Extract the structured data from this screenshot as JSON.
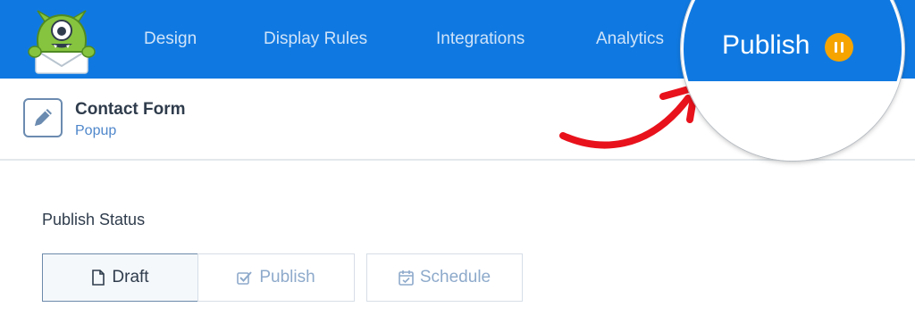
{
  "nav": {
    "items": [
      "Design",
      "Display Rules",
      "Integrations",
      "Analytics"
    ]
  },
  "publish_button": {
    "label": "Publish",
    "status_icon": "pause-icon",
    "status_color": "#f5a400"
  },
  "campaign": {
    "title": "Contact Form",
    "type": "Popup",
    "icon": "pencil-icon"
  },
  "publish_status": {
    "label": "Publish Status",
    "options": [
      {
        "label": "Draft",
        "icon": "file-icon",
        "selected": true
      },
      {
        "label": "Publish",
        "icon": "checkbox-icon",
        "selected": false
      },
      {
        "label": "Schedule",
        "icon": "calendar-icon",
        "selected": false
      }
    ]
  },
  "colors": {
    "brand_blue": "#1079e1",
    "annotation_red": "#e8121c",
    "text_dark": "#2f3c4c",
    "text_muted": "#8eaacb"
  }
}
